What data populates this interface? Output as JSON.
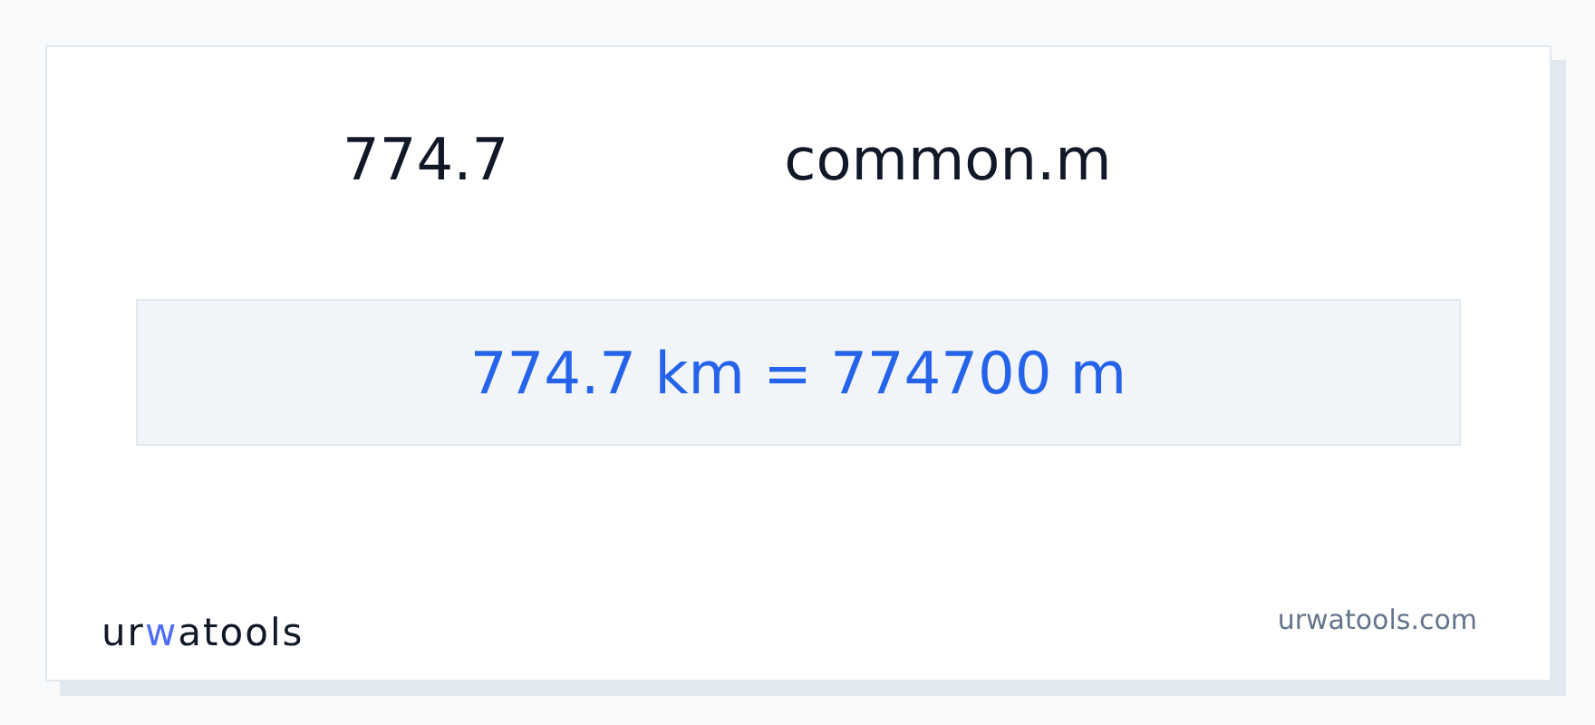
{
  "header": {
    "value": "774.7",
    "unit": "common.m"
  },
  "result": "774.7 km = 774700 m",
  "footer": {
    "logo": {
      "before": "ur",
      "accent": "w",
      "after": "atools"
    },
    "site": "urwatools.com"
  }
}
